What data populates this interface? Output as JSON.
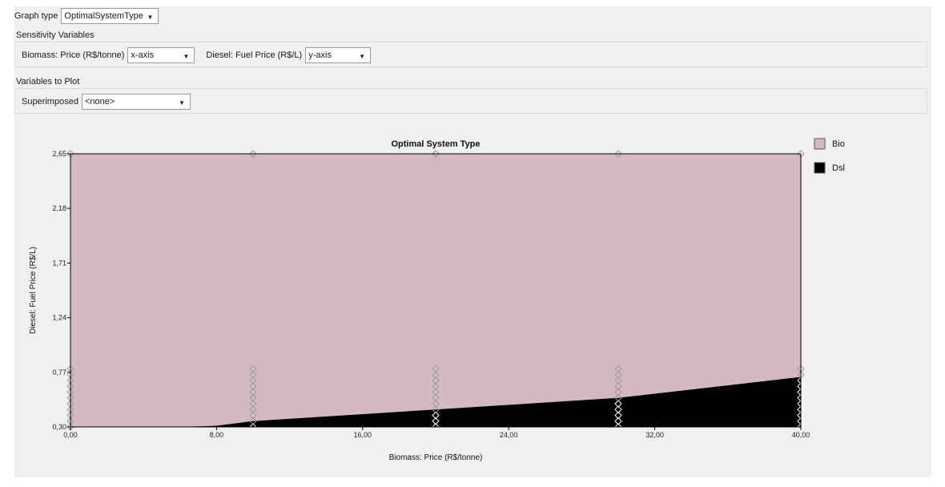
{
  "controls": {
    "graph_type_label": "Graph type",
    "graph_type_value": "OptimalSystemType",
    "sensitivity_title": "Sensitivity Variables",
    "biomass_label": "Biomass: Price (R$/tonne)",
    "biomass_axis": "x-axis",
    "diesel_label": "Diesel: Fuel Price (R$/L)",
    "diesel_axis": "y-axis",
    "plot_vars_title": "Variables to Plot",
    "superimposed_label": "Superimposed",
    "superimposed_value": "<none>"
  },
  "chart_data": {
    "type": "area",
    "title": "Optimal System Type",
    "xlabel": "Biomass: Price (R$/tonne)",
    "ylabel": "Diesel: Fuel Price (R$/L)",
    "xlim": [
      0,
      40
    ],
    "ylim": [
      0.3,
      2.65
    ],
    "x_ticks": [
      0,
      8,
      16,
      24,
      32,
      40
    ],
    "x_tick_labels": [
      "0,00",
      "8,00",
      "16,00",
      "24,00",
      "32,00",
      "40,00"
    ],
    "y_ticks": [
      0.3,
      0.77,
      1.24,
      1.71,
      2.18,
      2.65
    ],
    "y_tick_labels": [
      "0,30",
      "0,77",
      "1,24",
      "1,71",
      "2,18",
      "2,65"
    ],
    "grid": false,
    "legend_placement": "right",
    "series": [
      {
        "name": "Bio",
        "color": "#d4b9c4",
        "region": "above boundary"
      },
      {
        "name": "Dsl",
        "color": "#000000",
        "region": "below boundary"
      }
    ],
    "boundary": {
      "x": [
        0,
        6,
        8,
        10,
        20,
        30,
        40
      ],
      "y": [
        0.3,
        0.3,
        0.31,
        0.35,
        0.45,
        0.55,
        0.73
      ]
    },
    "markers": {
      "x": [
        0,
        10,
        20,
        30,
        40
      ],
      "y_low": [
        0.3,
        0.35,
        0.4,
        0.45,
        0.5,
        0.55,
        0.6,
        0.65,
        0.7,
        0.75,
        0.8
      ],
      "y_top": 2.65
    }
  }
}
